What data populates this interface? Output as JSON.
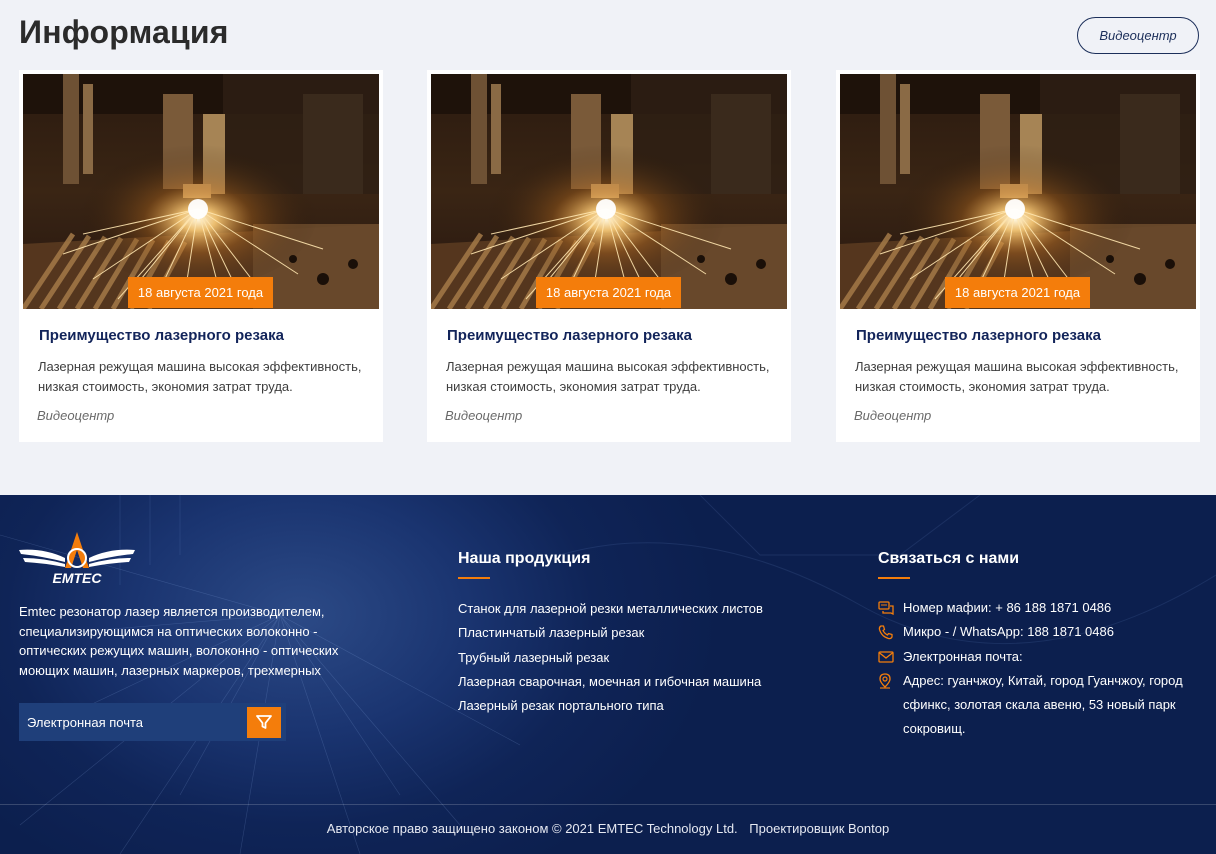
{
  "info": {
    "title": "Информация",
    "video_button": "Видеоцентр",
    "cards": [
      {
        "date": "18 августа 2021 года",
        "title": "Преимущество лазерного резака",
        "desc": "Лазерная режущая машина высокая эффективность, низкая стоимость, экономия затрат труда.",
        "category": "Видеоцентр"
      },
      {
        "date": "18 августа 2021 года",
        "title": "Преимущество лазерного резака",
        "desc": "Лазерная режущая машина высокая эффективность, низкая стоимость, экономия затрат труда.",
        "category": "Видеоцентр"
      },
      {
        "date": "18 августа 2021 года",
        "title": "Преимущество лазерного резака",
        "desc": "Лазерная режущая машина высокая эффективность, низкая стоимость, экономия затрат труда.",
        "category": "Видеоцентр"
      }
    ]
  },
  "footer": {
    "logo_text": "EMTEC",
    "about": "Emtec резонатор лазер является производителем, специализирующимся на оптических волоконно - оптических режущих машин, волоконно - оптических моющих машин, лазерных маркеров, трехмерных",
    "email_placeholder": "Электронная почта",
    "products_heading": "Наша продукция",
    "products": [
      "Станок для лазерной резки металлических листов",
      "Пластинчатый лазерный резак",
      "Трубный лазерный резак",
      "Лазерная сварочная, моечная и гибочная машина",
      "Лазерный резак портального типа"
    ],
    "contact_heading": "Связаться с нами",
    "contacts": [
      {
        "icon": "chat-icon",
        "text": "Номер мафии: + 86 188 1871 0486"
      },
      {
        "icon": "phone-icon",
        "text": "Микро - / WhatsApp: 188 1871 0486"
      },
      {
        "icon": "mail-icon",
        "text": "Электронная почта:"
      },
      {
        "icon": "location-icon",
        "text": "Адрес: гуанчжоу, Китай, город Гуанчжоу, город сфинкс, золотая скала авеню, 53 новый парк сокровищ."
      }
    ],
    "copyright": "Авторское право защищено законом © 2021 EMTEC Technology Ltd.",
    "designer": "Проектировщик Bontop"
  },
  "colors": {
    "accent": "#f47d0b",
    "navy": "#12245a",
    "footer_bg": "#0f2457"
  }
}
